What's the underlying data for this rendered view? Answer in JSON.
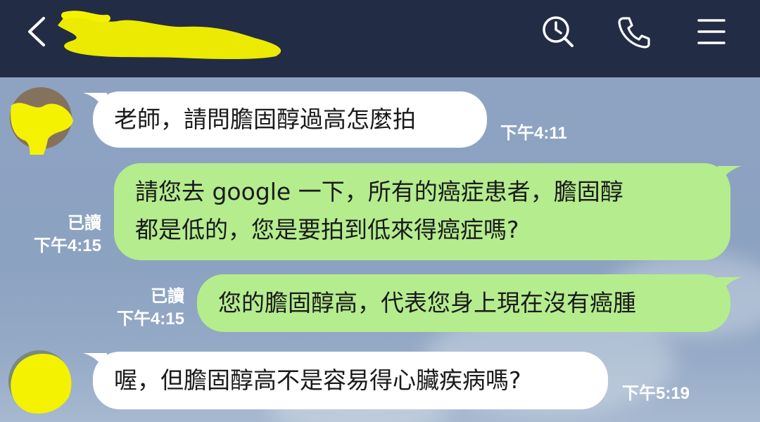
{
  "header": {
    "back_icon": "chevron-left-icon",
    "contact_name_redacted": true,
    "actions": [
      {
        "icon": "search-clock-icon",
        "label": "search"
      },
      {
        "icon": "phone-icon",
        "label": "call"
      },
      {
        "icon": "menu-icon",
        "label": "menu"
      }
    ],
    "background": "#232c45"
  },
  "messages": [
    {
      "direction": "incoming",
      "text": "老師，請問膽固醇過高怎麼拍",
      "time": "下午4:11"
    },
    {
      "direction": "outgoing",
      "lines": [
        "請您去 google 一下，所有的癌症患者，膽固醇",
        "都是低的，您是要拍到低來得癌症嗎?"
      ],
      "read": "已讀",
      "time": "下午4:15"
    },
    {
      "direction": "outgoing",
      "text": "您的膽固醇高，代表您身上現在沒有癌腫",
      "read": "已讀",
      "time": "下午4:15"
    },
    {
      "direction": "incoming",
      "text": "喔，但膽固醇高不是容易得心臟疾病嗎?",
      "time": "下午5:19"
    }
  ],
  "colors": {
    "incoming_bubble": "#ffffff",
    "outgoing_bubble": "#b5ec8e",
    "redaction": "#f5f200"
  }
}
